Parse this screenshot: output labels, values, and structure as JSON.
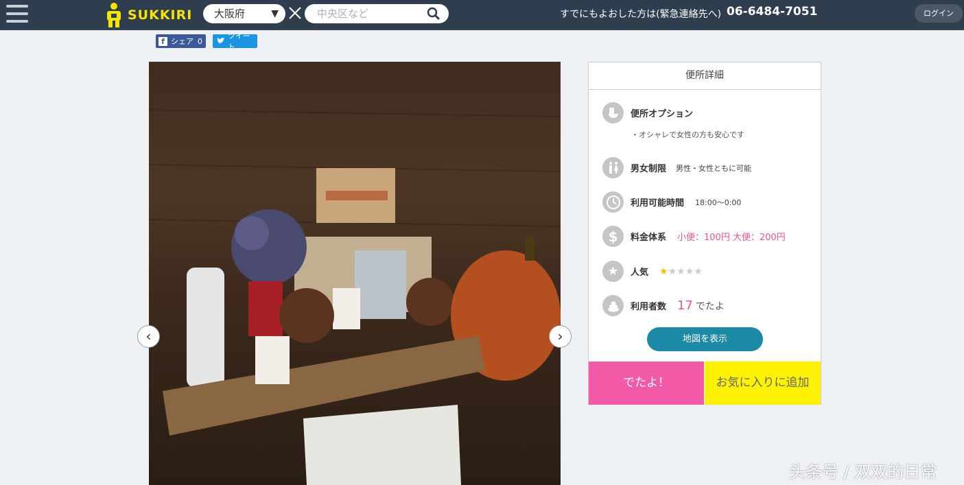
{
  "header": {
    "logo_text": "SUKKIRI",
    "prefecture": "大阪府",
    "search_placeholder": "中央区など",
    "emergency_text": "すでにもよおした方は(緊急連絡先へ)",
    "phone": "06-6484-7051",
    "login_label": "ログイン"
  },
  "social": {
    "share_label": "シェア",
    "share_count": "0",
    "tweet_label": "ツイート"
  },
  "panel": {
    "title": "便所詳細",
    "option_label": "便所オプション",
    "option_note": "・オシャレで女性の方も安心です",
    "gender_label": "男女制限",
    "gender_value": "男性・女性ともに可能",
    "hours_label": "利用可能時間",
    "hours_value": "18:00〜0:00",
    "fee_label": "料金体系",
    "fee_value": "小便：100円 大便：200円",
    "popularity_label": "人気",
    "popularity_rating": 1,
    "popularity_max": 5,
    "users_label": "利用者数",
    "users_count": "17",
    "users_unit": "でたよ",
    "map_button": "地図を表示",
    "deta_button": "でたよ！",
    "fav_button": "お気に入りに追加"
  },
  "watermark": "头条号 / 双双的日常",
  "colors": {
    "header_bg": "#2e3e4f",
    "logo_yellow": "#f7e400",
    "pink": "#f25aa8",
    "yellow": "#fff200",
    "teal": "#1b8aa6"
  }
}
